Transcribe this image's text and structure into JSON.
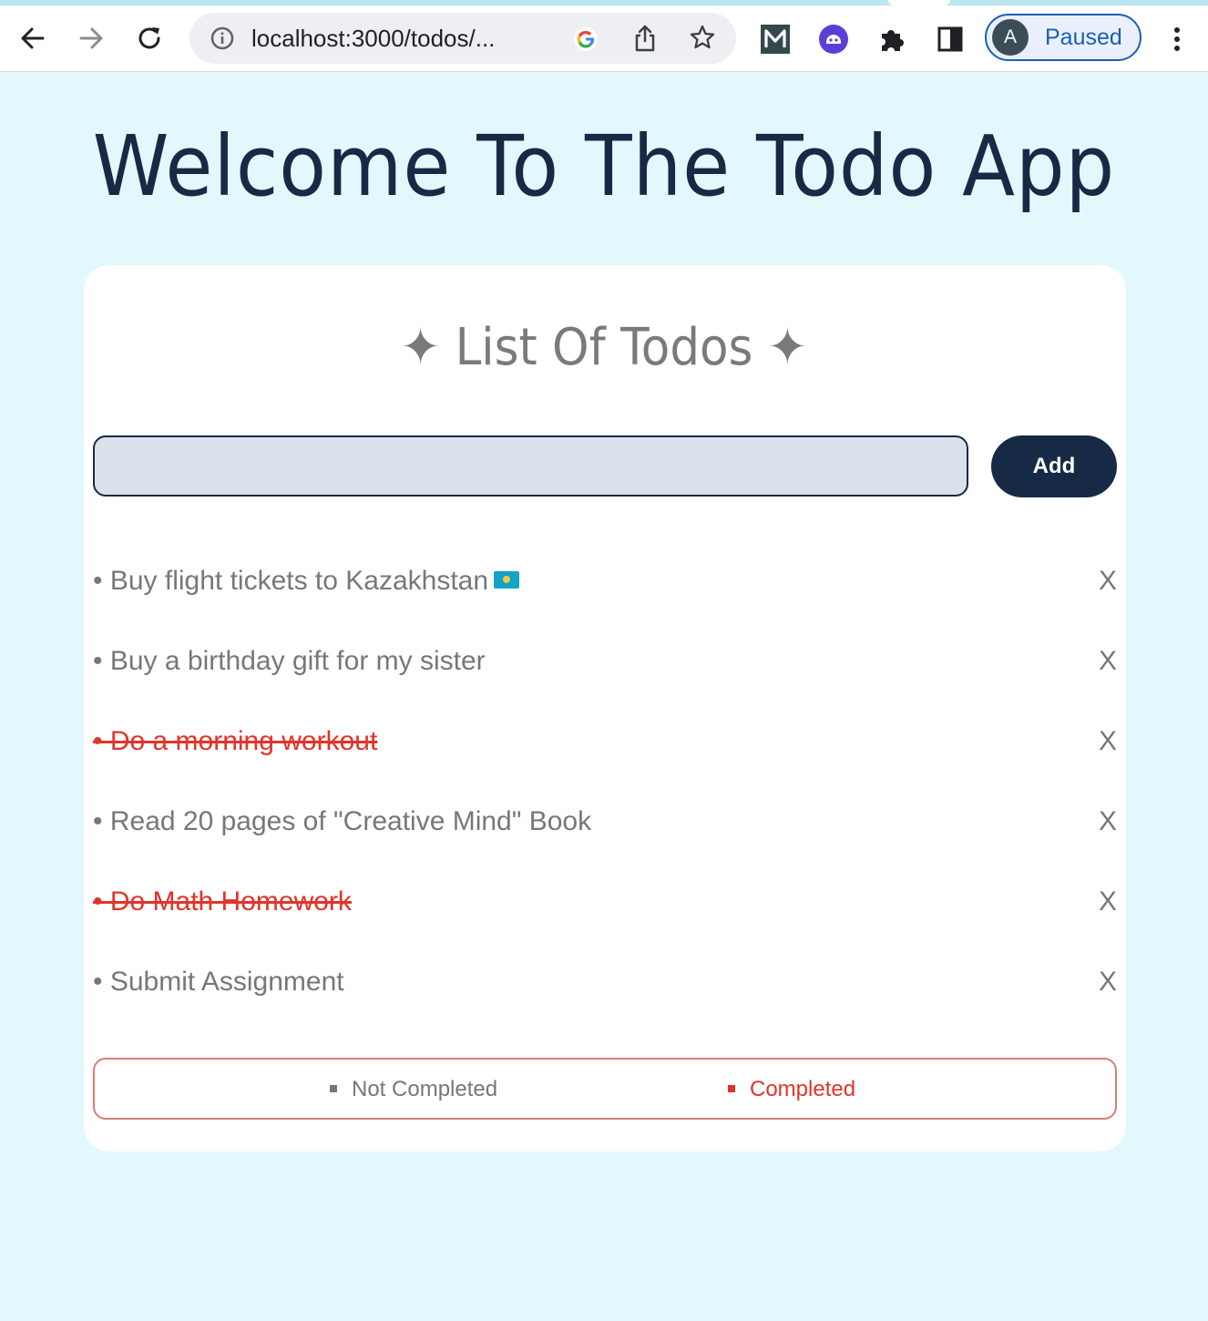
{
  "browser": {
    "url": "localhost:3000/todos/...",
    "profile_initial": "A",
    "profile_status": "Paused"
  },
  "page": {
    "title": "Welcome To The Todo App",
    "list_title": "✦ List Of Todos ✦",
    "input_placeholder": "",
    "add_label": "Add"
  },
  "todos": [
    {
      "text": "• Buy flight tickets to Kazakhstan",
      "completed": false,
      "delete_label": "X",
      "flag_icon": "kazakhstan-flag-icon"
    },
    {
      "text": "• Buy a birthday gift for my sister",
      "completed": false,
      "delete_label": "X"
    },
    {
      "text": "• Do a morning workout",
      "completed": true,
      "delete_label": "X"
    },
    {
      "text": "• Read 20 pages of \"Creative Mind\" Book",
      "completed": false,
      "delete_label": "X"
    },
    {
      "text": "• Do Math Homework",
      "completed": true,
      "delete_label": "X"
    },
    {
      "text": "• Submit Assignment",
      "completed": false,
      "delete_label": "X"
    }
  ],
  "legend": {
    "not_completed": "Not Completed",
    "completed": "Completed"
  },
  "colors": {
    "background": "#e2f8fc",
    "primary": "#172a45",
    "completed": "#e0352b",
    "muted": "#777777"
  }
}
